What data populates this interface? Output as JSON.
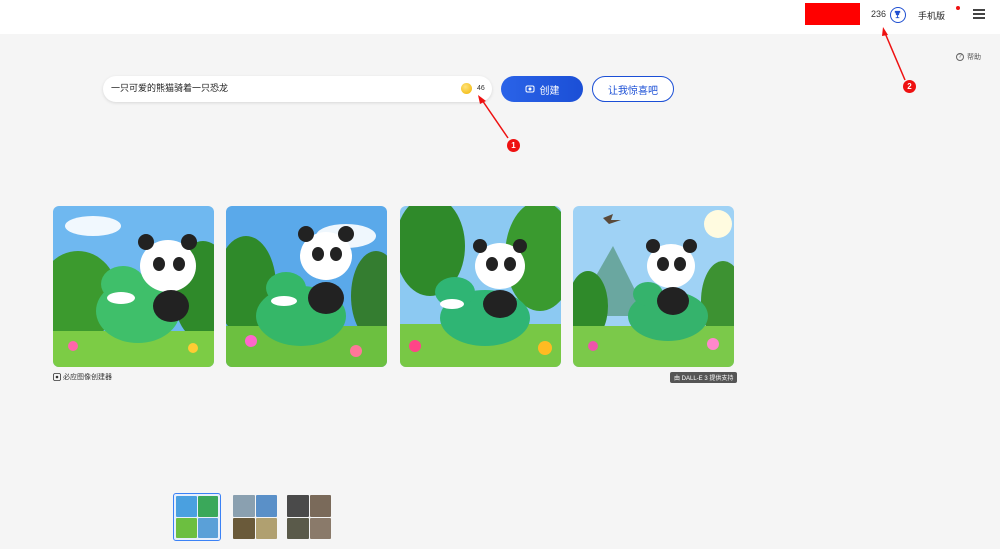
{
  "header": {
    "reward_count": "236",
    "mobile_label": "手机版",
    "help_label": "帮助"
  },
  "prompt": {
    "value": "一只可爱的熊猫骑着一只恐龙",
    "boost_count": "46"
  },
  "buttons": {
    "create_label": "创建",
    "surprise_label": "让我惊喜吧"
  },
  "results": {
    "images": [
      {
        "name": "panda-riding-dinosaur-1"
      },
      {
        "name": "panda-riding-dinosaur-2"
      },
      {
        "name": "panda-riding-dinosaur-3"
      },
      {
        "name": "panda-riding-dinosaur-4"
      }
    ],
    "caption_left": "必应图像创建器",
    "caption_right": "由 DALL-E 3 提供支持"
  },
  "annotations": {
    "callout_1": "1",
    "callout_2": "2"
  },
  "colors": {
    "accent": "#1b4fd6",
    "annotation": "#e11111",
    "redaction": "#ff0000"
  },
  "icons": [
    "trophy-icon",
    "menu-icon",
    "help-icon",
    "coin-icon",
    "create-icon",
    "image-creator-icon"
  ]
}
